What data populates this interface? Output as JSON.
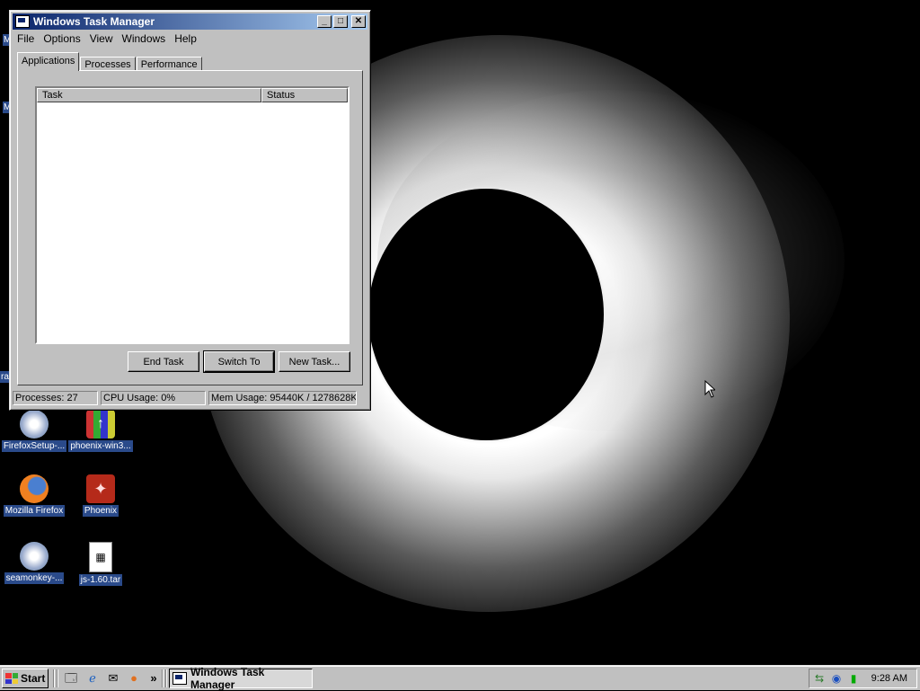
{
  "window": {
    "title": "Windows Task Manager",
    "menu": [
      "File",
      "Options",
      "View",
      "Windows",
      "Help"
    ],
    "tabs": [
      "Applications",
      "Processes",
      "Performance"
    ],
    "active_tab": "Applications",
    "columns": [
      "Task",
      "Status"
    ],
    "buttons": {
      "end_task": "End Task",
      "switch_to": "Switch To",
      "new_task": "New Task..."
    },
    "status": {
      "processes": "Processes: 27",
      "cpu": "CPU Usage: 0%",
      "mem": "Mem Usage: 95440K / 1278628K"
    },
    "controls": {
      "minimize": "_",
      "maximize": "□",
      "close": "✕"
    }
  },
  "desktop": {
    "icons": [
      {
        "label": "FirefoxSetup-...",
        "icon": "installer-cd-icon"
      },
      {
        "label": "phoenix-win3...",
        "icon": "archive-icon"
      },
      {
        "label": "Mozilla Firefox",
        "icon": "firefox-icon"
      },
      {
        "label": "Phoenix",
        "icon": "phoenix-icon"
      },
      {
        "label": "seamonkey-...",
        "icon": "installer-cd-icon"
      },
      {
        "label": "js-1.60.tar",
        "icon": "file-icon"
      }
    ],
    "edge_labels": [
      "M",
      "M",
      "ra"
    ]
  },
  "taskbar": {
    "start": "Start",
    "quick_launch": [
      "desktop-icon",
      "ie-icon",
      "outlook-icon",
      "firefox-icon"
    ],
    "overflow": "»",
    "task_button": "Windows Task Manager",
    "clock": "9:28 AM"
  }
}
